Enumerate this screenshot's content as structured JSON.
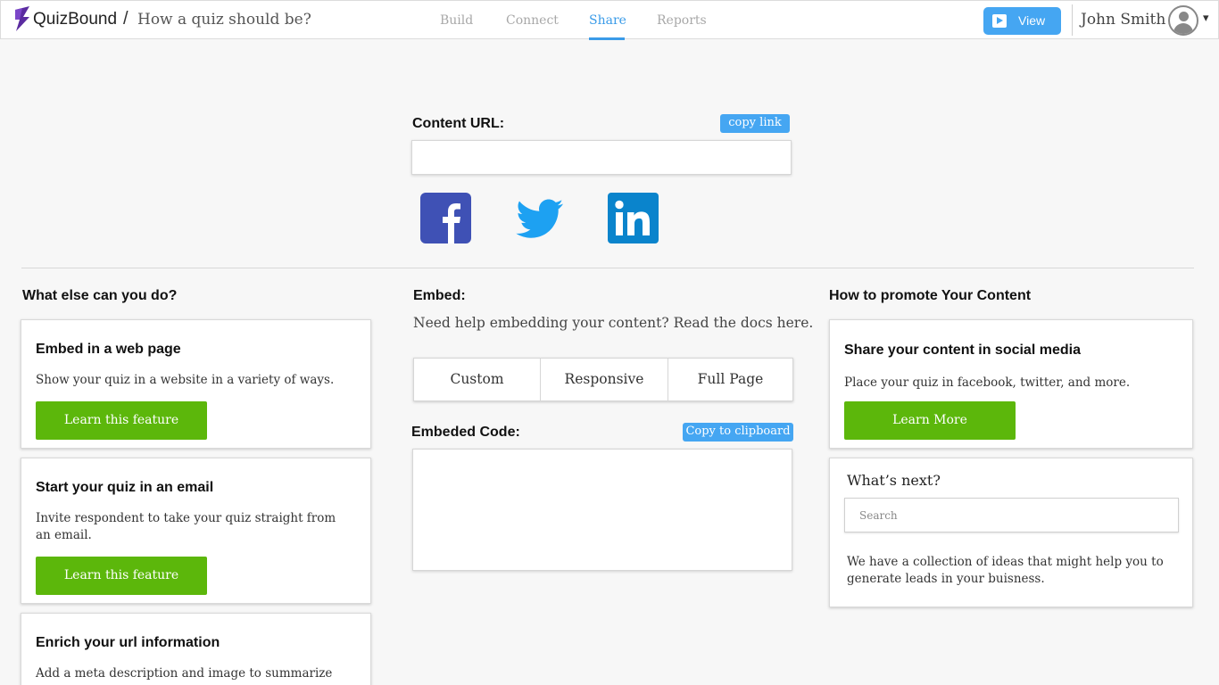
{
  "header": {
    "brand": {
      "part1": "Quiz",
      "part2": "Bound"
    },
    "separator": "/",
    "quiz_title": "How a quiz should be?",
    "tabs": [
      {
        "label": "Build",
        "active": false
      },
      {
        "label": "Connect",
        "active": false
      },
      {
        "label": "Share",
        "active": true
      },
      {
        "label": "Reports",
        "active": false
      }
    ],
    "view_label": "View",
    "user_name": "John Smith",
    "caret": "▾"
  },
  "content_url": {
    "label": "Content URL:",
    "copy_label": "copy link",
    "value": ""
  },
  "social": [
    {
      "icon": "facebook-icon",
      "letter": "f",
      "color": "#3f51b5"
    },
    {
      "icon": "twitter-icon",
      "color": "#1da1f2"
    },
    {
      "icon": "linkedin-icon",
      "letter": "in",
      "color": "#0a84cc"
    }
  ],
  "left_column": {
    "heading": "What else can you do?",
    "cards": [
      {
        "title": "Embed in a web page",
        "text": "Show your quiz in a website in a variety of ways.",
        "button": "Learn this feature"
      },
      {
        "title": "Start your quiz in an email",
        "text": "Invite respondent to take your quiz straight from an email.",
        "button": "Learn this feature"
      },
      {
        "title": "Enrich your url information",
        "text": "Add a meta description and image to summarize"
      }
    ]
  },
  "embed": {
    "heading": "Embed:",
    "help_text": "Need help embedding your content? Read the docs here.",
    "options": [
      "Custom",
      "Responsive",
      "Full Page"
    ],
    "code_label": "Embeded Code:",
    "copy_label": "Copy to clipboard",
    "code_value": ""
  },
  "right_column": {
    "heading": "How to promote Your Content",
    "social_card": {
      "title": "Share your content in social media",
      "text": "Place your quiz in facebook, twitter, and more.",
      "button": "Learn More"
    },
    "next_card": {
      "title": "What’s next?",
      "search_placeholder": "Search",
      "text": "We have a collection of ideas that might help you to generate leads in your buisness."
    }
  },
  "colors": {
    "accent_blue": "#45a6f2",
    "active_tab": "#3a9be8",
    "green": "#5cb70b",
    "brand_purple": "#5b2ca0"
  }
}
